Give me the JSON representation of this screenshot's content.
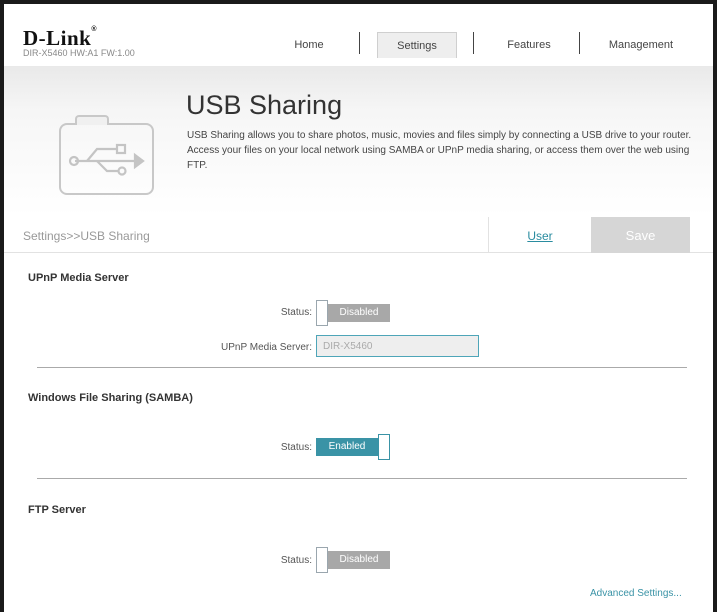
{
  "header": {
    "logo": "D-Link",
    "model": "DIR-X5460 HW:A1 FW:1.00",
    "nav": [
      {
        "label": "Home"
      },
      {
        "label": "Settings"
      },
      {
        "label": "Features"
      },
      {
        "label": "Management"
      }
    ],
    "active_nav": "Settings"
  },
  "banner": {
    "title": "USB Sharing",
    "description": "USB Sharing allows you to share photos, music, movies and files simply by connecting a USB drive to your router. Access your files on your local network using SAMBA or UPnP media sharing, or access them over the web using FTP.",
    "icon": "usb-icon"
  },
  "breadcrumb": {
    "path": "Settings>>USB Sharing",
    "user_label": "User",
    "save_label": "Save"
  },
  "upnp": {
    "title": "UPnP Media Server",
    "status_label": "Status:",
    "status_value": "Disabled",
    "server_label": "UPnP Media Server:",
    "server_value": "DIR-X5460"
  },
  "samba": {
    "title": "Windows File Sharing (SAMBA)",
    "status_label": "Status:",
    "status_value": "Enabled"
  },
  "ftp": {
    "title": "FTP Server",
    "status_label": "Status:",
    "status_value": "Disabled",
    "advanced_label": "Advanced Settings..."
  },
  "colors": {
    "accent": "#3a93a6",
    "disabled": "#a8a8a8",
    "save_bg": "#d6d6d6"
  }
}
